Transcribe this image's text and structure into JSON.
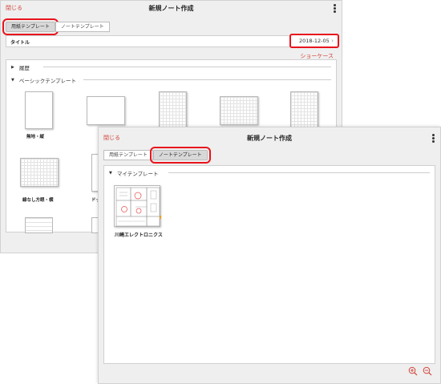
{
  "back_window": {
    "close_label": "閉じる",
    "title": "新規ノート作成",
    "tabs": [
      "用紙テンプレート",
      "ノートテンプレート"
    ],
    "title_field_label": "タイトル",
    "date": "2018-12-05",
    "showcase_label": "ショーケース",
    "sections": [
      "履歴",
      "ベーシックテンプレート"
    ],
    "templates": [
      {
        "label": "無地・縦",
        "style": "plain"
      },
      {
        "label": "",
        "style": "plain"
      },
      {
        "label": "",
        "style": "grid"
      },
      {
        "label": "",
        "style": "grid"
      },
      {
        "label": "",
        "style": "grid"
      },
      {
        "label": "線なし方眼・横",
        "style": "grid"
      },
      {
        "label": "ドッ",
        "style": "plain"
      }
    ],
    "highlight_color": "#e8141d"
  },
  "front_window": {
    "close_label": "閉じる",
    "title": "新規ノート作成",
    "tabs": [
      "用紙テンプレート",
      "ノートテンプレート"
    ],
    "section": "マイテンプレート",
    "template": {
      "label": "川崎エレクトロニクス"
    },
    "zoom_in_icon": "zoom-in-icon",
    "zoom_out_icon": "zoom-out-icon"
  },
  "accent_color": "#d2433a"
}
